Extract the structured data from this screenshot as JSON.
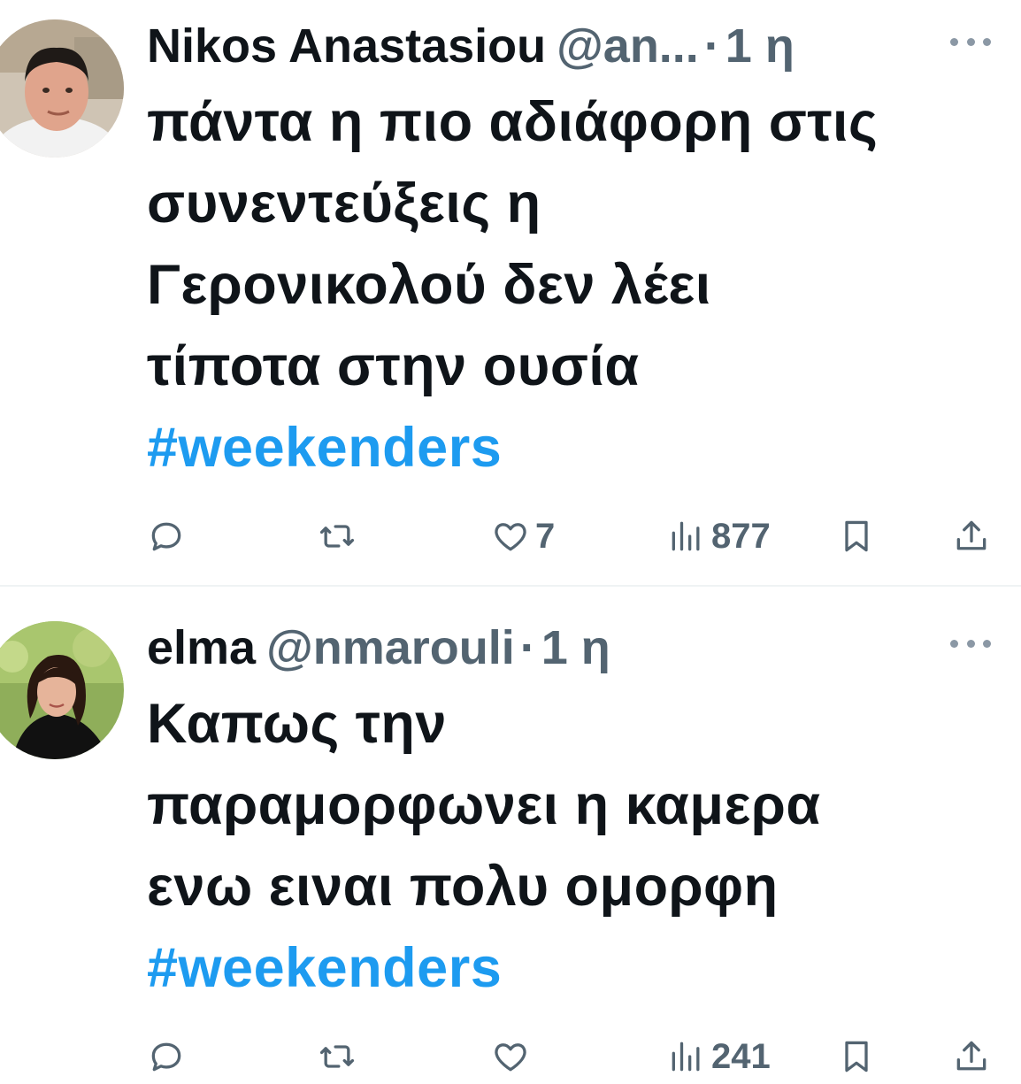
{
  "colors": {
    "text": "#0f1419",
    "secondary": "#536471",
    "hashtag": "#1d9bf0",
    "divider": "#eff3f4"
  },
  "tweets": [
    {
      "display_name": "Nikos Anastasiou",
      "handle": "@an...",
      "separator": "·",
      "time": "1 η",
      "avatar_icon": "avatar-man-photo",
      "lines": [
        "πάντα η πιο αδιάφορη στις",
        "συνεντεύξεις η",
        "Γερονικολού δεν λέει",
        "τίποτα στην ουσία"
      ],
      "hashtag": "#weekenders",
      "actions": {
        "reply_count": "",
        "retweet_count": "",
        "like_count": "7",
        "views_count": "877"
      }
    },
    {
      "display_name": "elma",
      "handle": "@nmarouli",
      "separator": "·",
      "time": "1 η",
      "avatar_icon": "avatar-woman-photo",
      "lines": [
        "Καπως την",
        "παραμορφωνει η καμερα",
        "ενω ειναι πολυ ομορφη"
      ],
      "hashtag": "#weekenders",
      "actions": {
        "reply_count": "",
        "retweet_count": "",
        "like_count": "",
        "views_count": "241"
      }
    }
  ]
}
